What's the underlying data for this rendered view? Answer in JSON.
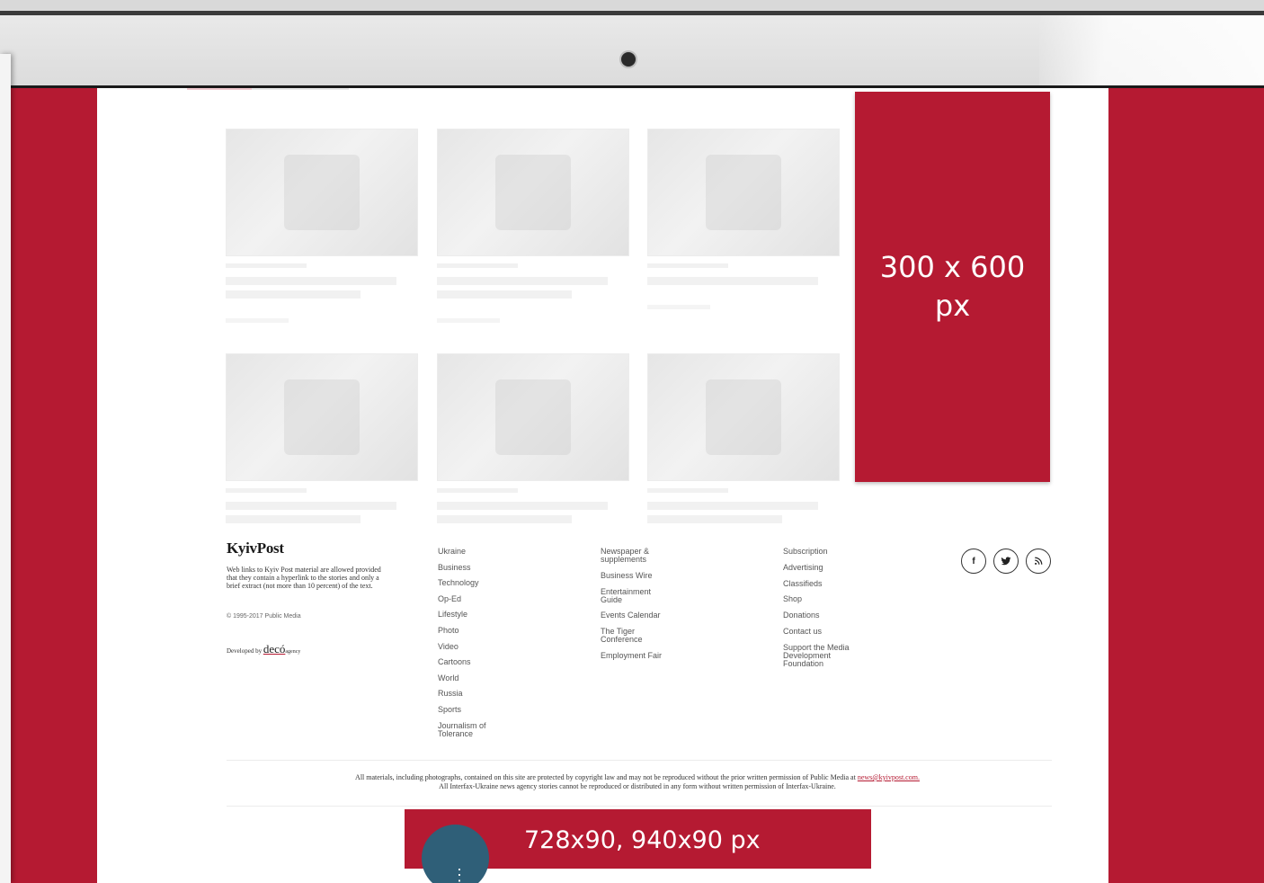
{
  "ads": {
    "sidebar_label": "300 x 600 px",
    "banner_label": "728x90, 940x90 px"
  },
  "scroll_badge": {
    "symbol": "⋮"
  },
  "footer": {
    "brand": "KyivPost",
    "disclaimer": "Web links to Kyiv Post material are allowed provided that they contain a hyperlink to the stories and only a brief extract (not more than 10 percent) of the text.",
    "copyright": "© 1995-2017 Public Media",
    "developed_by": "Developed by",
    "developer": "decó",
    "developer_suffix": "agency",
    "col1": [
      "Ukraine",
      "Business",
      "Technology",
      "Op-Ed",
      "Lifestyle",
      "Photo",
      "Video",
      "Cartoons",
      "World",
      "Russia",
      "Sports",
      "Journalism of Tolerance"
    ],
    "col2": [
      "Newspaper & supplements",
      "Business Wire",
      "Entertainment Guide",
      "Events Calendar",
      "The Tiger Conference",
      "Employment Fair"
    ],
    "col3": [
      "Subscription",
      "Advertising",
      "Classifieds",
      "Shop",
      "Donations",
      "Contact us",
      "Support the Media Development Foundation"
    ],
    "social": [
      "f",
      "t",
      "rss"
    ],
    "legal_line1": "All materials, including photographs, contained on this site are protected by copyright law and may not be reproduced without the prior written permission of Public Media at",
    "legal_email": "news@kyivpost.com.",
    "legal_line2": "All Interfax-Ukraine news agency stories cannot be reproduced or distributed in any form without written permission of Interfax-Ukraine."
  },
  "colors": {
    "accent": "#b51a32",
    "badge": "#2f5f78"
  }
}
